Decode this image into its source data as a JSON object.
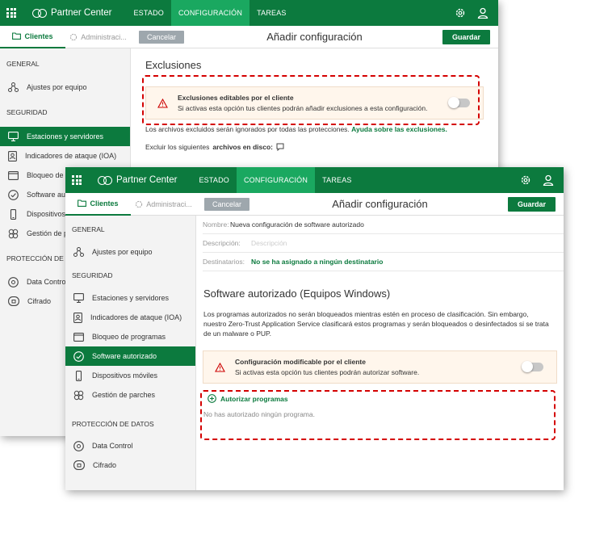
{
  "app": {
    "brand": "Partner Center",
    "nav": [
      "ESTADO",
      "CONFIGURACIÓN",
      "TAREAS"
    ],
    "active_nav": "CONFIGURACIÓN"
  },
  "colors": {
    "primary": "#0c7a3e",
    "active_nav": "#1aa860",
    "highlight_dashes": "#d40000",
    "warning_bg": "#fff6ec"
  },
  "back": {
    "tabs": {
      "clients": "Clientes",
      "admin": "Administraci..."
    },
    "buttons": {
      "cancel": "Cancelar",
      "save": "Guardar"
    },
    "title": "Añadir configuración",
    "sidebar": {
      "general_title": "GENERAL",
      "general_items": [
        "Ajustes por equipo"
      ],
      "security_title": "SEGURIDAD",
      "security_items": [
        "Estaciones y servidores",
        "Indicadores de ataque (IOA)",
        "Bloqueo de",
        "Software au",
        "Dispositivos",
        "Gestión de p"
      ],
      "data_title": "PROTECCIÓN DE DA",
      "data_items": [
        "Data Contro",
        "Cifrado"
      ]
    },
    "section_title": "Exclusiones",
    "warning": {
      "title": "Exclusiones editables por el cliente",
      "text": "Si activas esta opción tus clientes podrán añadir exclusiones a esta configuración."
    },
    "info_text": "Los archivos excluidos serán ignorados por todas las protecciones.",
    "info_link": "Ayuda sobre las exclusiones.",
    "exclude_prefix": "Excluir los siguientes",
    "exclude_bold": "archivos en disco:"
  },
  "front": {
    "tabs": {
      "clients": "Clientes",
      "admin": "Administraci..."
    },
    "buttons": {
      "cancel": "Cancelar",
      "save": "Guardar"
    },
    "title": "Añadir configuración",
    "sidebar": {
      "general_title": "GENERAL",
      "general_items": [
        "Ajustes por equipo"
      ],
      "security_title": "SEGURIDAD",
      "security_items": [
        "Estaciones y servidores",
        "Indicadores de ataque (IOA)",
        "Bloqueo de programas",
        "Software autorizado",
        "Dispositivos móviles",
        "Gestión de parches"
      ],
      "data_title": "PROTECCIÓN DE DATOS",
      "data_items": [
        "Data Control",
        "Cifrado"
      ]
    },
    "fields": {
      "name_label": "Nombre:",
      "name_value": "Nueva configuración de software autorizado",
      "desc_label": "Descripción:",
      "desc_placeholder": "Descripción",
      "dest_label": "Destinatarios:",
      "dest_value": "No se ha asignado a ningún destinatario"
    },
    "section_title": "Software autorizado (Equipos Windows)",
    "description": "Los programas autorizados no serán bloqueados mientras estén en proceso de clasificación. Sin embargo, nuestro Zero-Trust Application Service clasificará estos programas y serán bloqueados o desinfectados si se trata de un malware o PUP.",
    "warning": {
      "title": "Configuración modificable por el cliente",
      "text": "Si activas esta opción tus clientes podrán autorizar software."
    },
    "add_programs": "Autorizar programas",
    "empty_text": "No has autorizado ningún programa."
  }
}
